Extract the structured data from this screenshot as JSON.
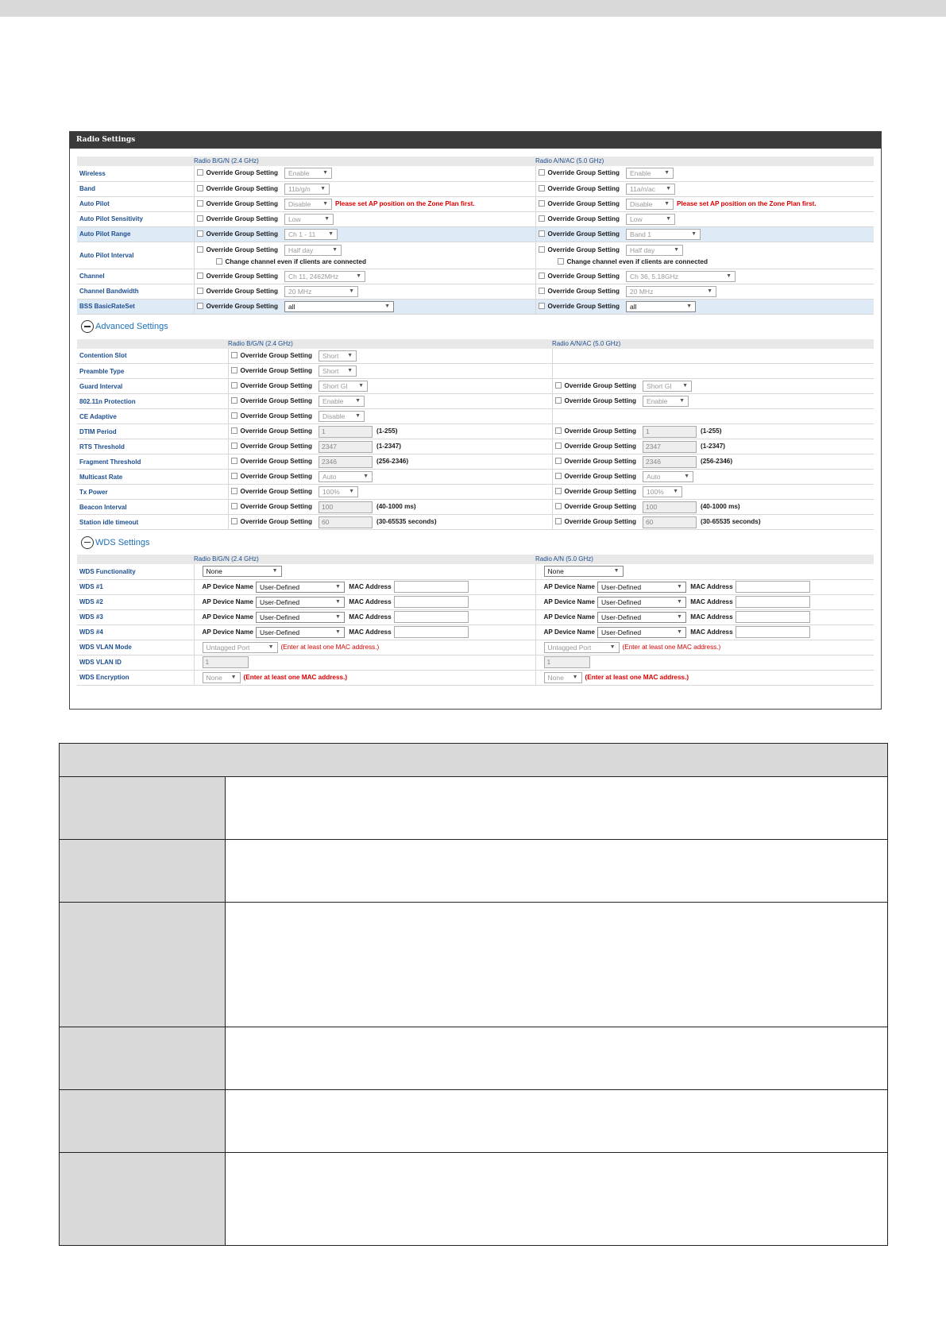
{
  "window": {
    "title": "Radio Settings"
  },
  "radio": {
    "col1": "Radio B/G/N (2.4 GHz)",
    "col2": "Radio A/N/AC (5.0 GHz)",
    "override": "Override Group Setting",
    "warn": "Please set AP position on the Zone Plan first.",
    "change_channel": "Change channel even if clients are connected",
    "rows": {
      "wireless": {
        "label": "Wireless",
        "v1": "Enable",
        "v2": "Enable"
      },
      "band": {
        "label": "Band",
        "v1": "11b/g/n",
        "v2": "11a/n/ac"
      },
      "autopilot": {
        "label": "Auto Pilot",
        "v1": "Disable",
        "v2": "Disable"
      },
      "sensitivity": {
        "label": "Auto Pilot Sensitivity",
        "v1": "Low",
        "v2": "Low"
      },
      "range": {
        "label": "Auto Pilot Range",
        "v1": "Ch 1 - 11",
        "v2": "Band 1"
      },
      "interval": {
        "label": "Auto Pilot Interval",
        "v1": "Half day",
        "v2": "Half day"
      },
      "channel": {
        "label": "Channel",
        "v1": "Ch 11, 2462MHz",
        "v2": "Ch 36, 5.18GHz"
      },
      "bandwidth": {
        "label": "Channel Bandwidth",
        "v1": "20 MHz",
        "v2": "20 MHz"
      },
      "bss": {
        "label": "BSS BasicRateSet",
        "v1": "all",
        "v2": "all"
      }
    }
  },
  "advanced": {
    "toggle": "Advanced Settings",
    "col1": "Radio B/G/N (2.4 GHz)",
    "col2": "Radio A/N/AC (5.0 GHz)",
    "rows": {
      "contention": {
        "label": "Contention Slot",
        "v1": "Short"
      },
      "preamble": {
        "label": "Preamble Type",
        "v1": "Short"
      },
      "guard": {
        "label": "Guard Interval",
        "v1": "Short GI",
        "v2": "Short GI"
      },
      "prot": {
        "label": "802.11n Protection",
        "v1": "Enable",
        "v2": "Enable"
      },
      "ce": {
        "label": "CE Adaptive",
        "v1": "Disable"
      },
      "dtim": {
        "label": "DTIM Period",
        "v1": "1",
        "v2": "1",
        "r": "(1-255)"
      },
      "rts": {
        "label": "RTS Threshold",
        "v1": "2347",
        "v2": "2347",
        "r": "(1-2347)"
      },
      "frag": {
        "label": "Fragment Threshold",
        "v1": "2346",
        "v2": "2346",
        "r": "(256-2346)"
      },
      "mcast": {
        "label": "Multicast Rate",
        "v1": "Auto",
        "v2": "Auto"
      },
      "txp": {
        "label": "Tx Power",
        "v1": "100%",
        "v2": "100%"
      },
      "beacon": {
        "label": "Beacon Interval",
        "v1": "100",
        "v2": "100",
        "r": "(40-1000 ms)"
      },
      "idle": {
        "label": "Station idle timeout",
        "v1": "60",
        "v2": "60",
        "r": "(30-65535 seconds)"
      }
    }
  },
  "wds": {
    "toggle": "WDS Settings",
    "col1": "Radio B/G/N (2.4 GHz)",
    "col2": "Radio A/N (5.0 GHz)",
    "ap_label": "AP Device Name",
    "mac_label": "MAC Address",
    "user_defined": "User-Defined",
    "warn": "(Enter at least one MAC address.)",
    "rows": {
      "func": {
        "label": "WDS Functionality",
        "v1": "None",
        "v2": "None"
      },
      "w1": {
        "label": "WDS #1"
      },
      "w2": {
        "label": "WDS #2"
      },
      "w3": {
        "label": "WDS #3"
      },
      "w4": {
        "label": "WDS #4"
      },
      "vlanmode": {
        "label": "WDS VLAN Mode",
        "v1": "Untagged Port",
        "v2": "Untagged Port"
      },
      "vlanid": {
        "label": "WDS VLAN ID",
        "v1": "1",
        "v2": "1"
      },
      "enc": {
        "label": "WDS Encryption",
        "v1": "None",
        "v2": "None"
      }
    }
  }
}
